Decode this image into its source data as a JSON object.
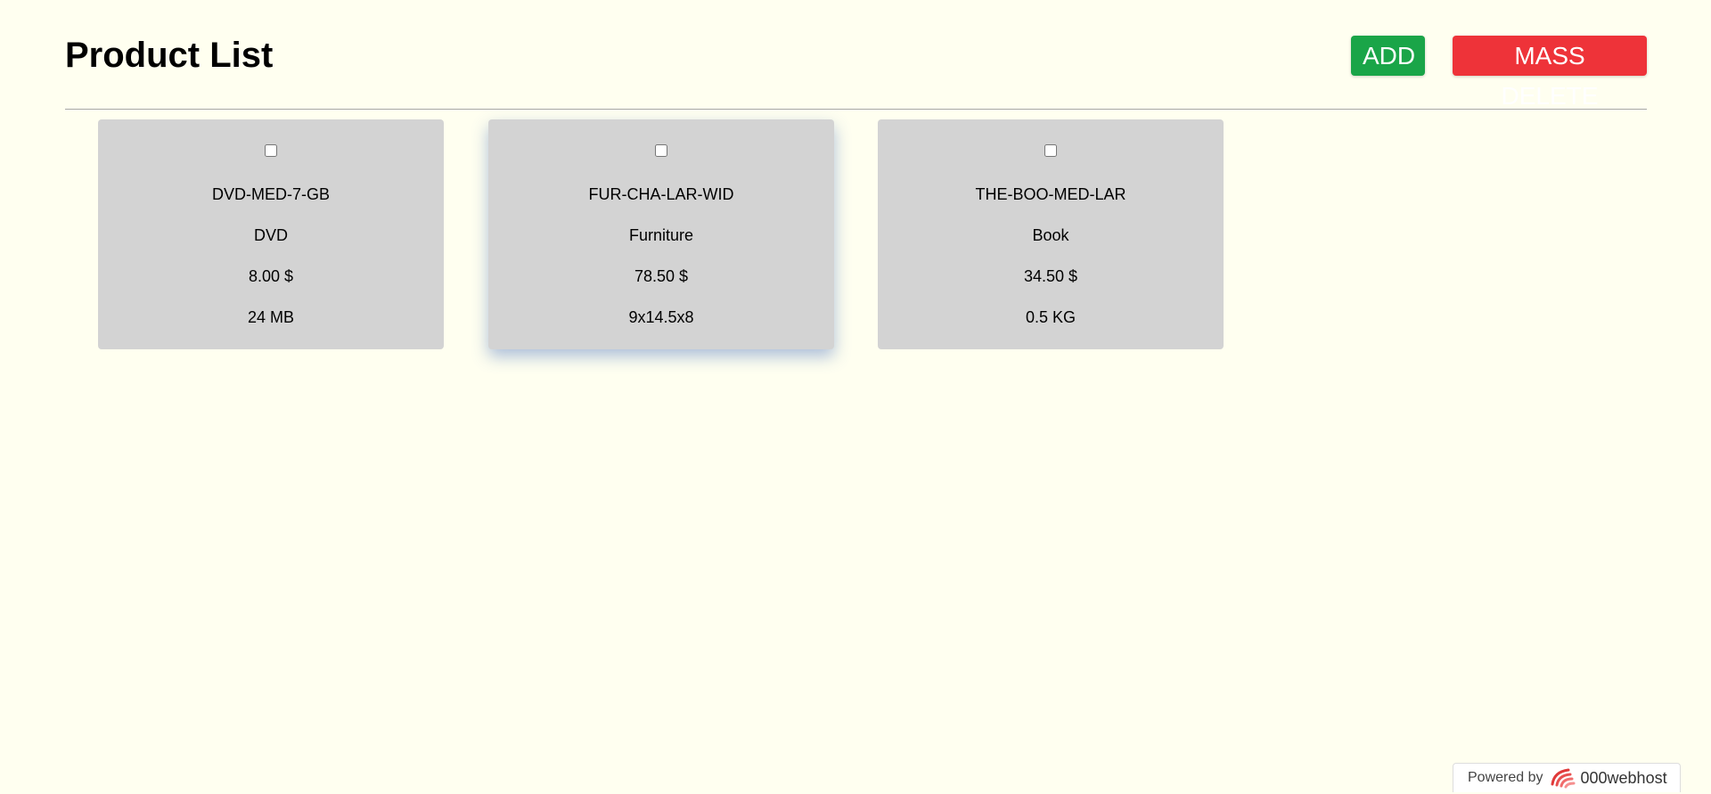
{
  "header": {
    "title": "Product List",
    "add_label": "ADD",
    "mass_delete_label": "MASS DELETE"
  },
  "products": [
    {
      "sku": "DVD-MED-7-GB",
      "name": "DVD",
      "price": "8.00 $",
      "attribute": "24 MB"
    },
    {
      "sku": "FUR-CHA-LAR-WID",
      "name": "Furniture",
      "price": "78.50 $",
      "attribute": "9x14.5x8"
    },
    {
      "sku": "THE-BOO-MED-LAR",
      "name": "Book",
      "price": "34.50 $",
      "attribute": "0.5 KG"
    }
  ],
  "footer": {
    "powered_by": "Powered by",
    "brand": "000webhost",
    "brand_icon": "000webhost-logo-icon"
  },
  "colors": {
    "background": "#fffff0",
    "add_button": "#1aa548",
    "delete_button": "#ee3339",
    "card": "#d3d3d3"
  }
}
